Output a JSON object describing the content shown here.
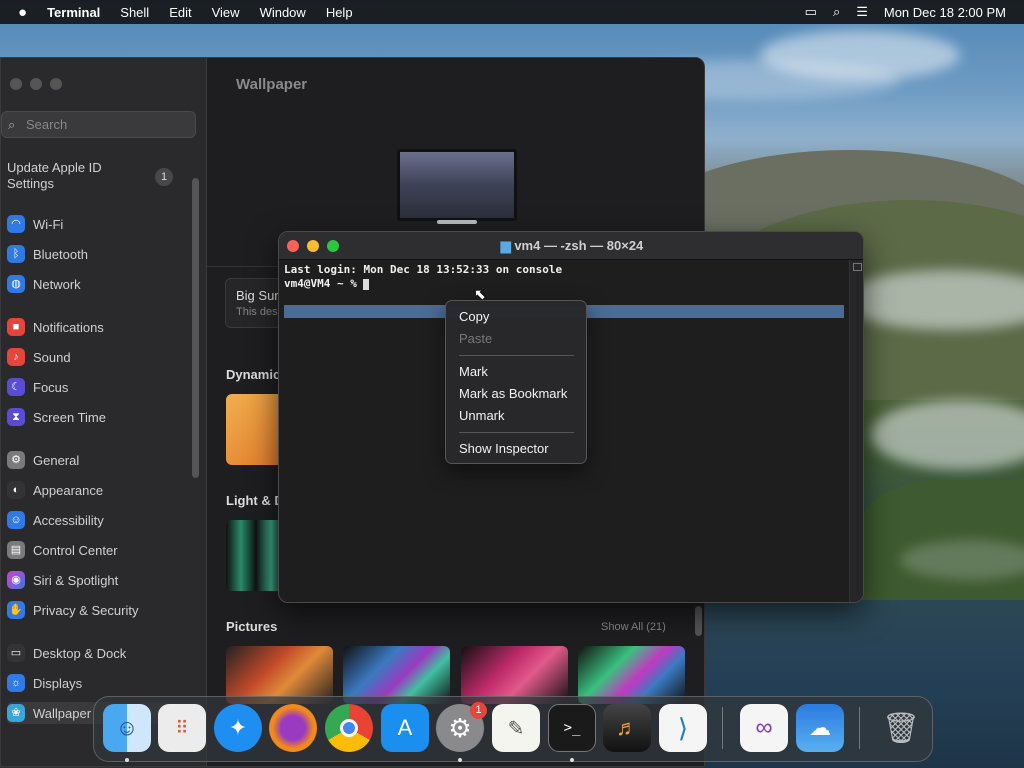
{
  "menubar": {
    "app": "Terminal",
    "items": [
      "Shell",
      "Edit",
      "View",
      "Window",
      "Help"
    ],
    "clock": "Mon Dec 18  2:00 PM"
  },
  "settings": {
    "search_placeholder": "Search",
    "apple_id": "Update Apple ID Settings",
    "apple_id_badge": "1",
    "sidebar": [
      "Wi-Fi",
      "Bluetooth",
      "Network",
      "Notifications",
      "Sound",
      "Focus",
      "Screen Time",
      "General",
      "Appearance",
      "Accessibility",
      "Control Center",
      "Siri & Spotlight",
      "Privacy & Security",
      "Desktop & Dock",
      "Displays",
      "Wallpaper"
    ],
    "title": "Wallpaper",
    "current_name": "Big Sur",
    "current_desc": "This des",
    "section_dynamic": "Dynamic",
    "section_light": "Light & D",
    "section_pictures": "Pictures",
    "show_all": "Show All (21)"
  },
  "terminal": {
    "title": "vm4 — -zsh — 80×24",
    "line1": "Last login: Mon Dec 18 13:52:33 on console",
    "line2": "vm4@VM4 ~ % "
  },
  "context_menu": {
    "copy": "Copy",
    "paste": "Paste",
    "mark": "Mark",
    "mark_bookmark": "Mark as Bookmark",
    "unmark": "Unmark",
    "inspector": "Show Inspector"
  },
  "dock": {
    "apps": [
      "Finder",
      "Launchpad",
      "Safari",
      "Firefox",
      "Chrome",
      "App Store",
      "System Settings",
      "TextEdit",
      "Terminal",
      "GarageBand",
      "VS Code",
      "Visual Studio",
      "Weather",
      "Trash"
    ],
    "settings_badge": "1"
  }
}
